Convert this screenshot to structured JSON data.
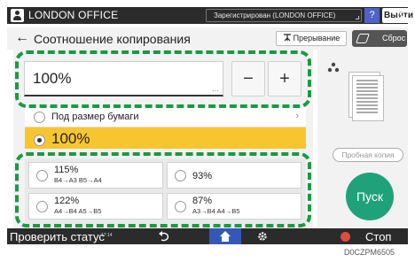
{
  "top_bar": {
    "user_name": "LONDON OFFICE",
    "login_status": "Зарегистрирован (LONDON OFFICE)",
    "help_label": "?",
    "logout_label": "Выйти"
  },
  "title_bar": {
    "title": "Соотношение копирования",
    "interrupt_label": "Прерывание",
    "reset_label": "Сброс"
  },
  "zoom": {
    "value": "100%",
    "minus_label": "−",
    "plus_label": "+"
  },
  "fit_to_paper_label": "Под размер бумаги",
  "selected_ratio": "100%",
  "presets": [
    {
      "pct": "115%",
      "paper": "B4→A3  B5→A4"
    },
    {
      "pct": "93%",
      "paper": ""
    },
    {
      "pct": "122%",
      "paper": "A4→B4  A5→B5"
    },
    {
      "pct": "87%",
      "paper": "A3→B4  A4→B5"
    }
  ],
  "right_panel": {
    "proof_copy_label": "Пробная копия",
    "start_label": "Пуск"
  },
  "bottom_bar": {
    "status_label": "Проверить статус",
    "clock": "17:14",
    "stop_label": "Стоп"
  },
  "caption": "D0CZPM6505",
  "colors": {
    "callout": "#1a9a43",
    "start_button": "#1fa27a",
    "selected_row": "#f7c62f",
    "home_button": "#3558b8",
    "help_button": "#4d63c8"
  },
  "icons": [
    "user-icon",
    "moon-icon",
    "back-arrow-icon",
    "interrupt-icon",
    "eraser-icon",
    "copy-dots-icon",
    "document-preview-icon",
    "undo-icon",
    "home-icon",
    "gear-icon",
    "stop-icon"
  ]
}
